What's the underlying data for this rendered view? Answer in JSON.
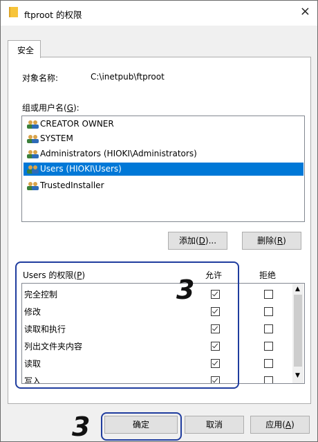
{
  "window": {
    "title": "ftproot 的权限",
    "close_glyph": "×"
  },
  "tab": {
    "label": "安全"
  },
  "object": {
    "label": "对象名称:",
    "value": "C:\\inetpub\\ftproot"
  },
  "group_label": {
    "text": "组或用户名(",
    "key": "G",
    "suffix": "):"
  },
  "users": [
    {
      "name": "CREATOR OWNER",
      "selected": false
    },
    {
      "name": "SYSTEM",
      "selected": false
    },
    {
      "name": "Administrators (HIOKI\\Administrators)",
      "selected": false
    },
    {
      "name": "Users (HIOKI\\Users)",
      "selected": true
    },
    {
      "name": "TrustedInstaller",
      "selected": false
    }
  ],
  "buttons": {
    "add": {
      "text": "添加(",
      "key": "D",
      "suffix": ")..."
    },
    "remove": {
      "text": "删除(",
      "key": "R",
      "suffix": ")"
    },
    "ok": "确定",
    "cancel": "取消",
    "apply": {
      "text": "应用(",
      "key": "A",
      "suffix": ")"
    }
  },
  "perm_header": {
    "text": "Users 的权限(",
    "key": "P",
    "suffix": ")",
    "allow": "允许",
    "deny": "拒绝"
  },
  "permissions": [
    {
      "name": "完全控制",
      "allow": true,
      "deny": false
    },
    {
      "name": "修改",
      "allow": true,
      "deny": false
    },
    {
      "name": "读取和执行",
      "allow": true,
      "deny": false
    },
    {
      "name": "列出文件夹内容",
      "allow": true,
      "deny": false
    },
    {
      "name": "读取",
      "allow": true,
      "deny": false
    },
    {
      "name": "写入",
      "allow": true,
      "deny": false
    }
  ],
  "callouts": {
    "step": "3"
  },
  "colors": {
    "selection": "#0078d7",
    "callout": "#1f3c9e"
  }
}
